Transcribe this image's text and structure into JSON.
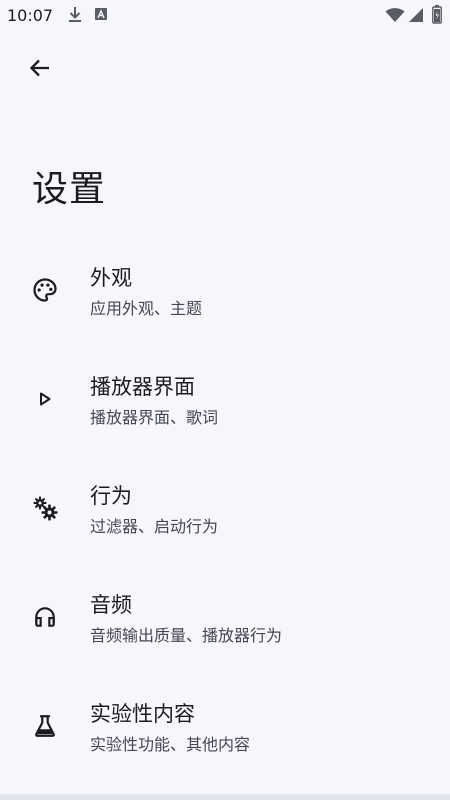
{
  "status_bar": {
    "time": "10:07",
    "icons": [
      "download-icon",
      "app-notification-icon",
      "wifi-icon",
      "signal-icon",
      "battery-icon"
    ]
  },
  "header": {
    "back_icon": "arrow-back-icon",
    "title": "设置"
  },
  "settings": {
    "items": [
      {
        "icon": "palette-icon",
        "title": "外观",
        "subtitle": "应用外观、主题"
      },
      {
        "icon": "play-icon",
        "title": "播放器界面",
        "subtitle": "播放器界面、歌词"
      },
      {
        "icon": "gears-icon",
        "title": "行为",
        "subtitle": "过滤器、启动行为"
      },
      {
        "icon": "headphones-icon",
        "title": "音频",
        "subtitle": "音频输出质量、播放器行为"
      },
      {
        "icon": "flask-icon",
        "title": "实验性内容",
        "subtitle": "实验性功能、其他内容"
      }
    ]
  },
  "colors": {
    "background": "#f6f7fc",
    "text_primary": "#1b1c20",
    "text_secondary": "#45464f"
  }
}
